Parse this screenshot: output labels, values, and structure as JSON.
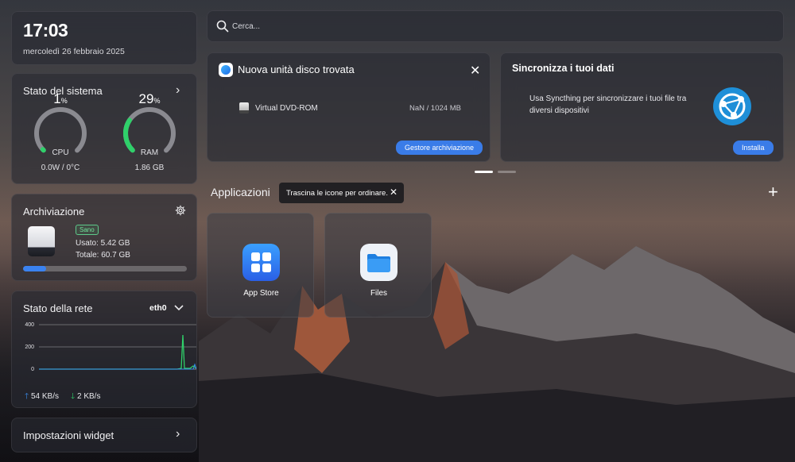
{
  "clock": {
    "time": "17:03",
    "date": "mercoledì 26 febbraio 2025"
  },
  "system": {
    "title": "Stato del sistema",
    "cpu": {
      "value": "1",
      "unit": "%",
      "label": "CPU",
      "sub": "0.0W / 0°C",
      "percent": 1
    },
    "ram": {
      "value": "29",
      "unit": "%",
      "label": "RAM",
      "sub": "1.86 GB",
      "percent": 29
    }
  },
  "storage": {
    "title": "Archiviazione",
    "badge": "Sano",
    "used": "Usato: 5.42 GB",
    "total": "Totale: 60.7 GB",
    "fill_percent": 14
  },
  "network": {
    "title": "Stato della rete",
    "interface": "eth0",
    "y_ticks": [
      "400",
      "200",
      "0"
    ],
    "upload": "54 KB/s",
    "download": "2 KB/s"
  },
  "widget_settings": {
    "label": "Impostazioni widget"
  },
  "search": {
    "placeholder": "Cerca..."
  },
  "disk_notice": {
    "title": "Nuova unità disco trovata",
    "device_name": "Virtual DVD-ROM",
    "device_size": "NaN / 1024 MB",
    "button": "Gestore archiviazione"
  },
  "sync_notice": {
    "title": "Sincronizza i tuoi dati",
    "description": "Usa Syncthing per sincronizzare i tuoi file tra diversi dispositivi",
    "button": "Installa"
  },
  "apps": {
    "title": "Applicazioni",
    "tooltip": "Trascina le icone per ordinare.",
    "items": [
      {
        "label": "App Store",
        "icon": "app-store-icon"
      },
      {
        "label": "Files",
        "icon": "folder-icon"
      }
    ]
  },
  "colors": {
    "accent": "#3a7ce8",
    "gauge_active": "#2fd06a",
    "gauge_track": "#8a8a90"
  }
}
